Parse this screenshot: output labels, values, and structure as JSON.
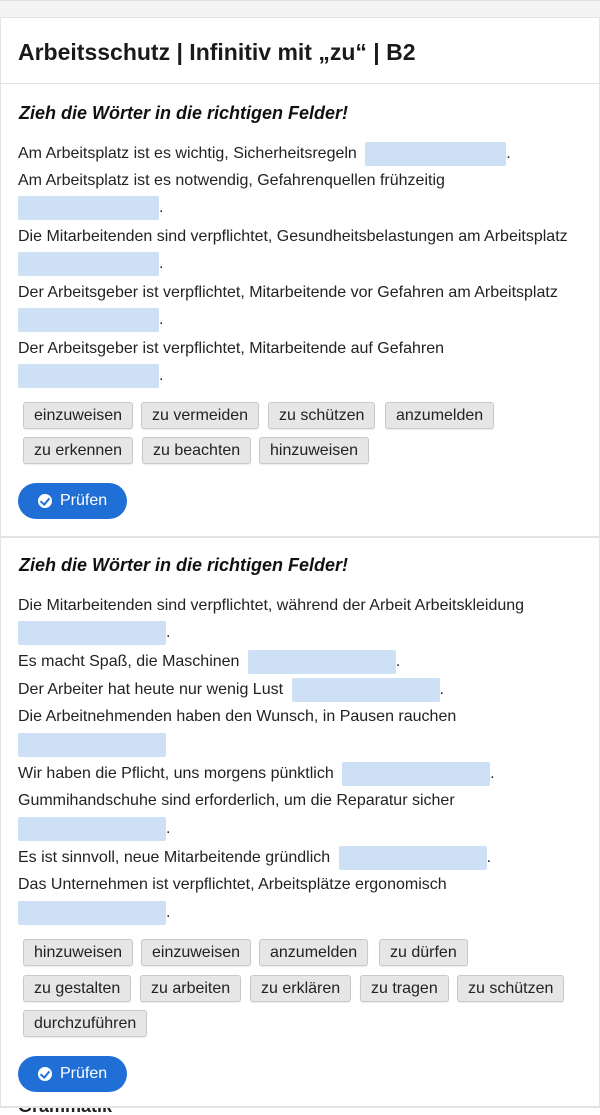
{
  "page": {
    "title": "Arbeitsschutz | Infinitiv mit „zu“ | B2",
    "next_section_peek": "Grammatik"
  },
  "exercise1": {
    "instruction": "Zieh die Wörter in die richtigen Felder!",
    "sentences": [
      "Am Arbeitsplatz ist es wichtig, Sicherheitsregeln",
      "Am Arbeitsplatz ist es notwendig, Gefahrenquellen frühzeitig",
      "Die Mitarbeitenden sind verpflichtet, Gesundheitsbelastungen am Arbeitsplatz",
      "Der Arbeitsgeber ist verpflichtet, Mitarbeitende vor Gefahren am Arbeitsplatz",
      "Der Arbeitsgeber ist verpflichtet, Mitarbeitende auf Gefahren"
    ],
    "period": ".",
    "words": [
      "einzuweisen",
      "zu vermeiden",
      "zu schützen",
      "anzumelden",
      "zu erkennen",
      "zu beachten",
      "hinzuweisen"
    ],
    "check_label": "Prüfen"
  },
  "exercise2": {
    "instruction": "Zieh die Wörter in die richtigen Felder!",
    "sentences": [
      "Die Mitarbeitenden sind verpflichtet, während der Arbeit Arbeitskleidung",
      "Es macht Spaß, die Maschinen",
      "Der Arbeiter hat heute nur wenig Lust",
      "Die Arbeitnehmenden haben den Wunsch, in Pausen rauchen",
      "Wir haben die Pflicht, uns morgens pünktlich",
      "Gummihandschuhe sind erforderlich, um die Reparatur sicher",
      "Es ist sinnvoll, neue Mitarbeitende gründlich",
      "Das Unternehmen ist verpflichtet, Arbeitsplätze ergonomisch"
    ],
    "period": ".",
    "words": [
      "hinzuweisen",
      "einzuweisen",
      "anzumelden",
      "zu dürfen",
      "zu gestalten",
      "zu arbeiten",
      "zu erklären",
      "zu tragen",
      "zu schützen",
      "durchzuführen"
    ],
    "check_label": "Prüfen"
  },
  "colors": {
    "accent": "#1f6fd6",
    "gap_fill": "#cde0f5",
    "chip_bg": "#e6e6e6"
  },
  "icons": {
    "check_button_icon": "check-circle-icon"
  }
}
